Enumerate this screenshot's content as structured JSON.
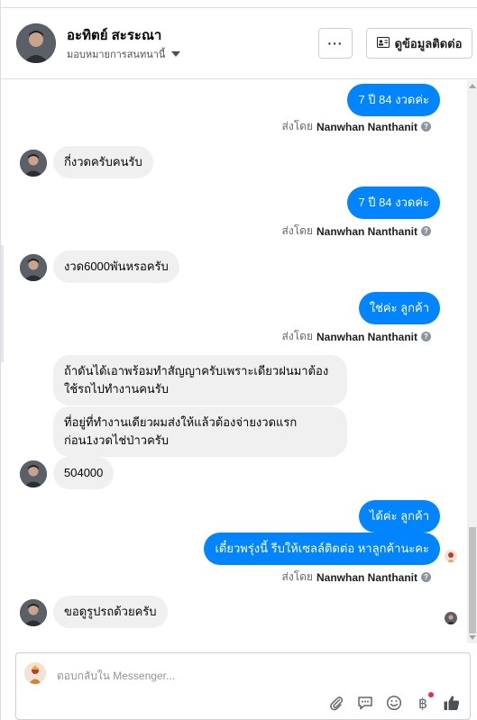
{
  "header": {
    "contact_name": "อะทิตย์ สะระณา",
    "assign_label": "มอบหมายการสนทนานี้",
    "more_label": "···",
    "contact_info_label": "ดูข้อมูลติดต่อ"
  },
  "sent_by": {
    "prefix": "ส่งโดย",
    "agent": "Nanwhan Nanthanit"
  },
  "messages": {
    "m1": "7 ปี 84 งวดค่ะ",
    "m2": "กี่งวดครับคนรับ",
    "m3": "7 ปี 84 งวดค่ะ",
    "m4": "งวด6000พันหรอครับ",
    "m5": "ใช่ค่ะ ลูกค้า",
    "m6": "ถ้าดันได้เอาพร้อมทำสัญญาครับเพราะเดียวฝนมาต้องใช้รถไปทำงานคนรับ",
    "m7": "ที่อยู่ที่ทำงานเดียวผมส่งให้แล้วต้องจ่ายงวดแรกก่อน1งวดไช่ป่าวครับ",
    "m8": "504000",
    "m9": "ได้ค่ะ ลูกค้า",
    "m10": "เดี๋ยวพรุ่งนี้ รีบให้เซลล์ติดต่อ หาลูกค้านะคะ",
    "m11": "ขอดูรูปรถด้วยครับ"
  },
  "composer": {
    "placeholder": "ตอบกลับใน Messenger...",
    "tools": [
      "attachment-icon",
      "saved-reply-icon",
      "emoji-icon",
      "payment-icon",
      "like-icon"
    ]
  },
  "colors": {
    "outgoing_bubble": "#0084ff",
    "incoming_bubble": "#f0f0f0",
    "notification_dot": "#f02849"
  }
}
